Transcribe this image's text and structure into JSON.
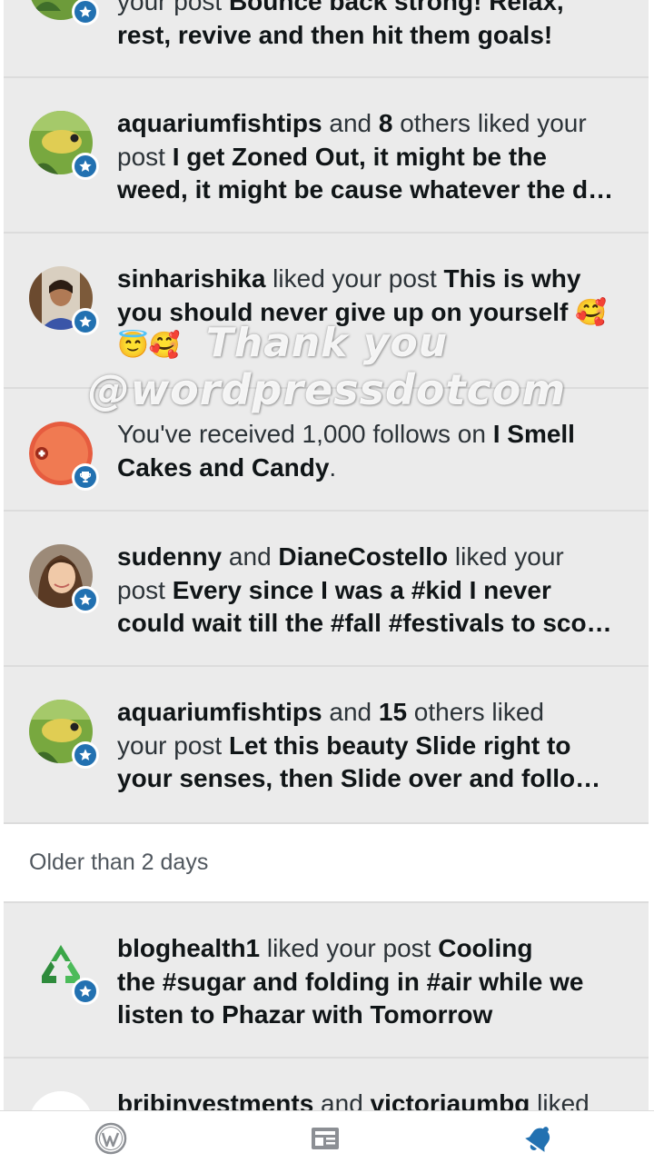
{
  "notifications": [
    {
      "lines": [
        {
          "parts": [
            {
              "t": "your post ",
              "b": false
            },
            {
              "t": "Bounce back strong! Relax,",
              "b": true
            }
          ]
        },
        {
          "parts": [
            {
              "t": "rest, revive and then hit them goals!",
              "b": true
            }
          ]
        }
      ]
    },
    {
      "lines": [
        {
          "parts": [
            {
              "t": "aquariumfishtips",
              "b": true
            },
            {
              "t": " and ",
              "b": false
            },
            {
              "t": "8",
              "b": true
            },
            {
              "t": " others liked your",
              "b": false
            }
          ]
        },
        {
          "parts": [
            {
              "t": "post ",
              "b": false
            },
            {
              "t": "I get Zoned Out, it might be the",
              "b": true
            }
          ]
        },
        {
          "parts": [
            {
              "t": "weed, it might be cause whatever the d…",
              "b": true
            }
          ]
        }
      ]
    },
    {
      "lines": [
        {
          "parts": [
            {
              "t": "sinharishika",
              "b": true
            },
            {
              "t": " liked your post ",
              "b": false
            },
            {
              "t": "This is why",
              "b": true
            }
          ]
        },
        {
          "parts": [
            {
              "t": "you should never give up on yourself 🥰",
              "b": true
            }
          ]
        },
        {
          "parts": [
            {
              "t": "😇🥰",
              "b": true
            }
          ]
        }
      ]
    },
    {
      "badge_value": "1000",
      "lines": [
        {
          "parts": [
            {
              "t": "You've received 1,000 follows on ",
              "b": false
            },
            {
              "t": "I Smell",
              "b": true
            }
          ]
        },
        {
          "parts": [
            {
              "t": "Cakes and Candy",
              "b": true
            },
            {
              "t": ".",
              "b": false
            }
          ]
        }
      ]
    },
    {
      "lines": [
        {
          "parts": [
            {
              "t": "sudenny",
              "b": true
            },
            {
              "t": " and ",
              "b": false
            },
            {
              "t": "DianeCostello",
              "b": true
            },
            {
              "t": " liked your",
              "b": false
            }
          ]
        },
        {
          "parts": [
            {
              "t": "post ",
              "b": false
            },
            {
              "t": "Every since I was a #kid I never",
              "b": true
            }
          ]
        },
        {
          "parts": [
            {
              "t": "could wait till the #fall #festivals to sco…",
              "b": true
            }
          ]
        }
      ]
    },
    {
      "lines": [
        {
          "parts": [
            {
              "t": "aquariumfishtips",
              "b": true
            },
            {
              "t": " and ",
              "b": false
            },
            {
              "t": "15",
              "b": true
            },
            {
              "t": " others liked",
              "b": false
            }
          ]
        },
        {
          "parts": [
            {
              "t": "your post ",
              "b": false
            },
            {
              "t": "Let this beauty Slide right to",
              "b": true
            }
          ]
        },
        {
          "parts": [
            {
              "t": "your senses, then Slide over and follo…",
              "b": true
            }
          ]
        }
      ]
    },
    {
      "lines": [
        {
          "parts": [
            {
              "t": "bloghealth1",
              "b": true
            },
            {
              "t": " liked your post ",
              "b": false
            },
            {
              "t": "Cooling",
              "b": true
            }
          ]
        },
        {
          "parts": [
            {
              "t": "the #sugar and folding in #air while we",
              "b": true
            }
          ]
        },
        {
          "parts": [
            {
              "t": "listen to Phazar with Tomorrow",
              "b": true
            }
          ]
        }
      ]
    },
    {
      "lines": [
        {
          "parts": [
            {
              "t": "bribinvestments",
              "b": true
            },
            {
              "t": " and ",
              "b": false
            },
            {
              "t": "victoriaumbg",
              "b": true
            },
            {
              "t": " liked",
              "b": false
            }
          ]
        }
      ]
    }
  ],
  "section": {
    "older_label": "Older than 2 days"
  },
  "watermark": {
    "line1": "Thank you",
    "line2": "@wordpressdotcom"
  },
  "nav": {
    "items": [
      "wordpress-logo-icon",
      "reader-icon",
      "notifications-bell-icon"
    ],
    "active_color": "#2271b1",
    "inactive_color": "#8c8f94"
  },
  "colors": {
    "accent": "#2271b1",
    "card_bg": "#ebebeb",
    "follow_badge": "#e65c3f"
  }
}
